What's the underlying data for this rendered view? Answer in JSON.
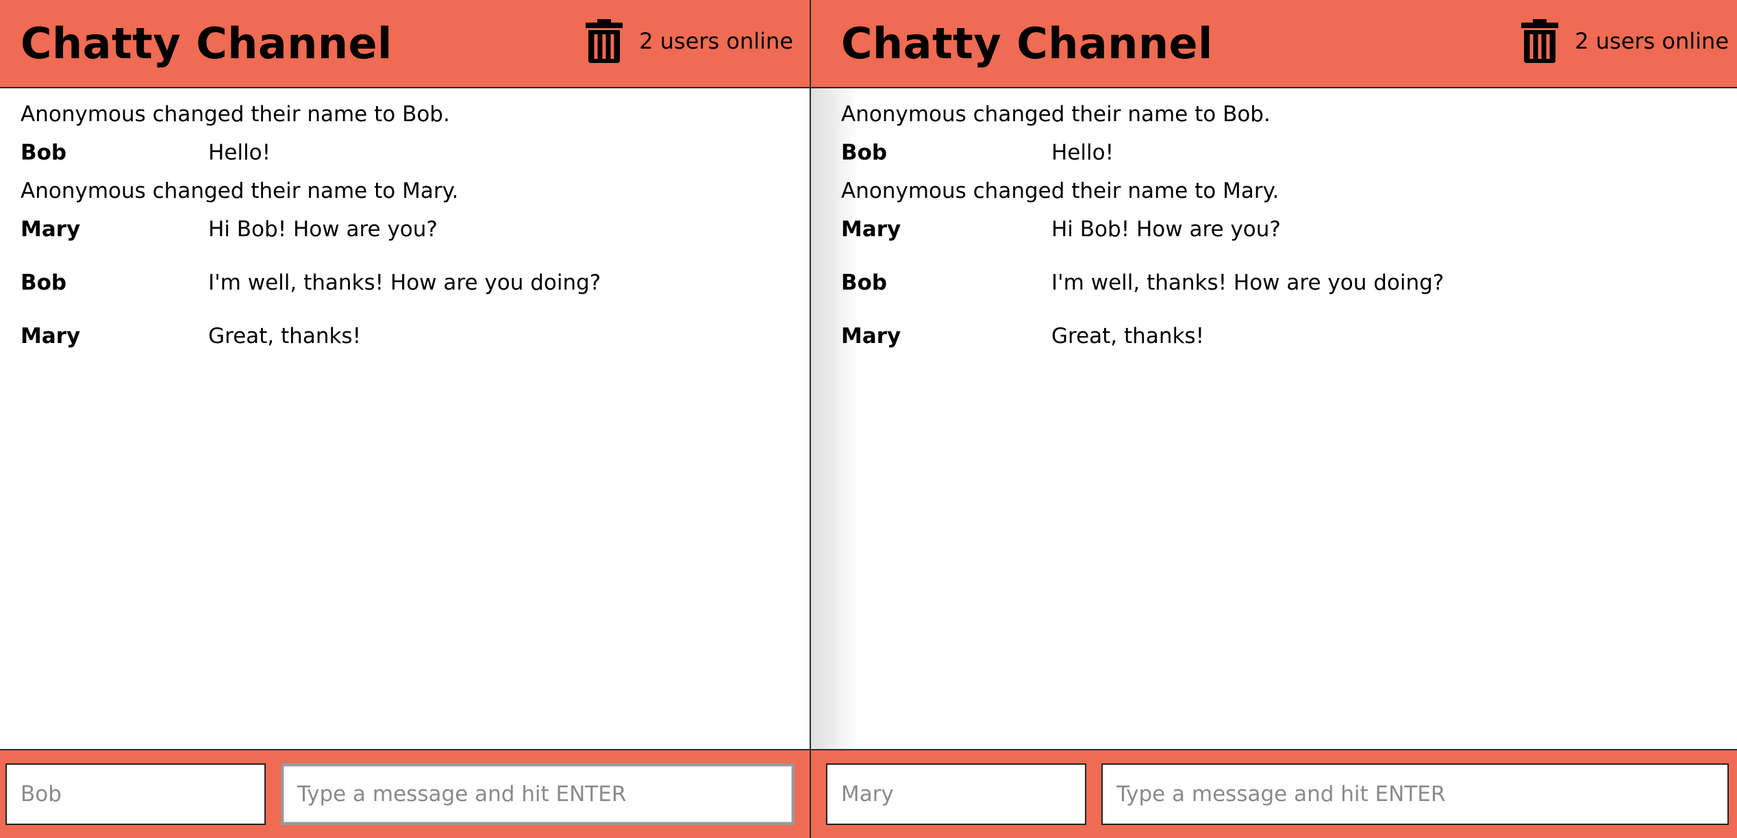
{
  "colors": {
    "header_bg": "#ef6b53",
    "divider": "#2b2b2b"
  },
  "panes": [
    {
      "title": "Chatty Channel",
      "trash_icon": "trash-icon",
      "online": "2 users online",
      "messages": [
        {
          "type": "notification",
          "content": "Anonymous changed their name to Bob."
        },
        {
          "type": "message",
          "user": "Bob",
          "content": "Hello!"
        },
        {
          "type": "notification",
          "content": "Anonymous changed their name to Mary."
        },
        {
          "type": "message",
          "user": "Mary",
          "content": "Hi Bob! How are you?"
        },
        {
          "type": "message",
          "user": "Bob",
          "content": "I'm well, thanks! How are you doing?"
        },
        {
          "type": "message",
          "user": "Mary",
          "content": "Great, thanks!"
        }
      ],
      "username_value": "",
      "username_placeholder": "Bob",
      "message_value": "",
      "message_placeholder": "Type a message and hit ENTER"
    },
    {
      "title": "Chatty Channel",
      "trash_icon": "trash-icon",
      "online": "2 users online",
      "messages": [
        {
          "type": "notification",
          "content": "Anonymous changed their name to Bob."
        },
        {
          "type": "message",
          "user": "Bob",
          "content": "Hello!"
        },
        {
          "type": "notification",
          "content": "Anonymous changed their name to Mary."
        },
        {
          "type": "message",
          "user": "Mary",
          "content": "Hi Bob! How are you?"
        },
        {
          "type": "message",
          "user": "Bob",
          "content": "I'm well, thanks! How are you doing?"
        },
        {
          "type": "message",
          "user": "Mary",
          "content": "Great, thanks!"
        }
      ],
      "username_value": "",
      "username_placeholder": "Mary",
      "message_value": "",
      "message_placeholder": "Type a message and hit ENTER"
    }
  ]
}
